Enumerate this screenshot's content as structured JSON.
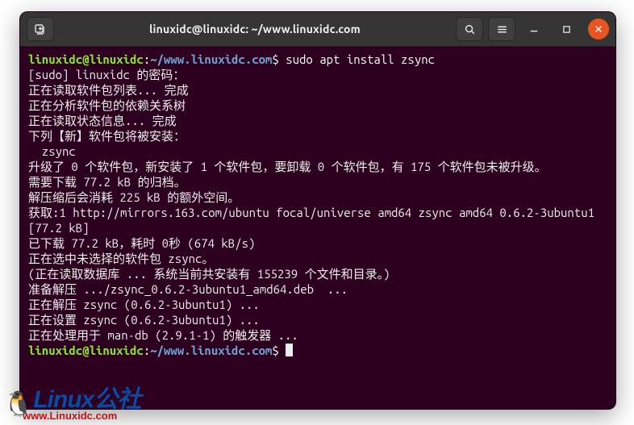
{
  "titlebar": {
    "title": "linuxidc@linuxidc: ~/www.linuxidc.com"
  },
  "prompt": {
    "user_host": "linuxidc@linuxidc",
    "colon": ":",
    "path": "~/www.linuxidc.com",
    "dollar": "$"
  },
  "command": "sudo apt install zsync",
  "lines": {
    "l1": "[sudo] linuxidc 的密码：",
    "l2": "正在读取软件包列表... 完成",
    "l3": "正在分析软件包的依赖关系树",
    "l4": "正在读取状态信息... 完成",
    "l5": "下列【新】软件包将被安装：",
    "l6": "  zsync",
    "l7": "升级了 0 个软件包，新安装了 1 个软件包，要卸载 0 个软件包，有 175 个软件包未被升级。",
    "l8": "需要下载 77.2 kB 的归档。",
    "l9": "解压缩后会消耗 225 kB 的额外空间。",
    "l10": "获取:1 http://mirrors.163.com/ubuntu focal/universe amd64 zsync amd64 0.6.2-3ubuntu1 [77.2 kB]",
    "l11": "已下载 77.2 kB，耗时 0秒 (674 kB/s)",
    "l12": "正在选中未选择的软件包 zsync。",
    "l13": "(正在读取数据库 ... 系统当前共安装有 155239 个文件和目录。)",
    "l14": "准备解压 .../zsync_0.6.2-3ubuntu1_amd64.deb  ...",
    "l15": "正在解压 zsync (0.6.2-3ubuntu1) ...",
    "l16": "正在设置 zsync (0.6.2-3ubuntu1) ...",
    "l17": "正在处理用于 man-db (2.9.1-1) 的触发器 ..."
  },
  "watermark": {
    "brand": "Linux",
    "suffix": "公社",
    "url": "www.Linuxidc.com"
  }
}
